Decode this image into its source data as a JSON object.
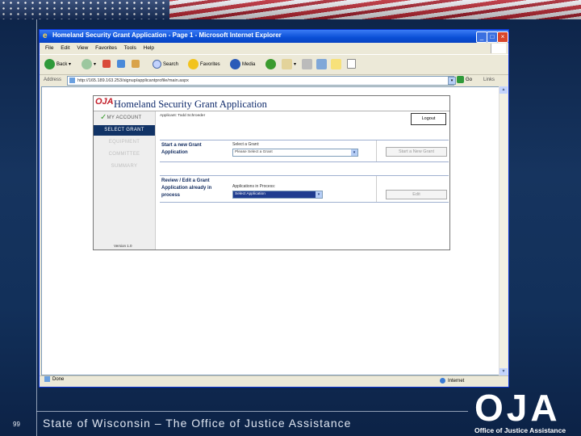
{
  "slide": {
    "number": "99",
    "footer_text": "State of Wisconsin – The Office of Justice Assistance",
    "logo_text": "OJA",
    "logo_subtext": "Office of Justice Assistance"
  },
  "browser": {
    "title": "Homeland Security Grant Application - Page 1 - Microsoft Internet Explorer",
    "menu": [
      "File",
      "Edit",
      "View",
      "Favorites",
      "Tools",
      "Help"
    ],
    "toolbar": {
      "back": "Back",
      "search": "Search",
      "favorites": "Favorites",
      "media": "Media"
    },
    "address_label": "Address",
    "address_value": "http://165.189.163.253/signup/applicantprofile/main.aspx",
    "go_label": "Go",
    "links_label": "Links",
    "status_left": "Done",
    "status_right": "Internet"
  },
  "app": {
    "logo": "OJA",
    "title": "Homeland Security Grant Application",
    "applicant_label": "Applicant: Todd Schroeder",
    "logout_label": "Logout",
    "sidebar": [
      {
        "label": "MY ACCOUNT",
        "state": "done"
      },
      {
        "label": "SELECT GRANT",
        "state": "active"
      },
      {
        "label": "EQUIPMENT",
        "state": "disabled"
      },
      {
        "label": "COMMITTEE",
        "state": "disabled"
      },
      {
        "label": "SUMMARY",
        "state": "disabled"
      }
    ],
    "version": "Version 1.0",
    "new_grant": {
      "label": "Start a new Grant Application",
      "select_label": "Select a Grant:",
      "select_value": "Please Select a Grant",
      "button": "Start a New Grant"
    },
    "existing_grant": {
      "label": "Review / Edit a Grant Application already in process",
      "select_label": "Applications in Process:",
      "select_value": "Select Application",
      "button": "Edit"
    }
  },
  "colors": {
    "accent": "#113366",
    "titlebar": "#0a4fd6",
    "background": "#12305a"
  }
}
